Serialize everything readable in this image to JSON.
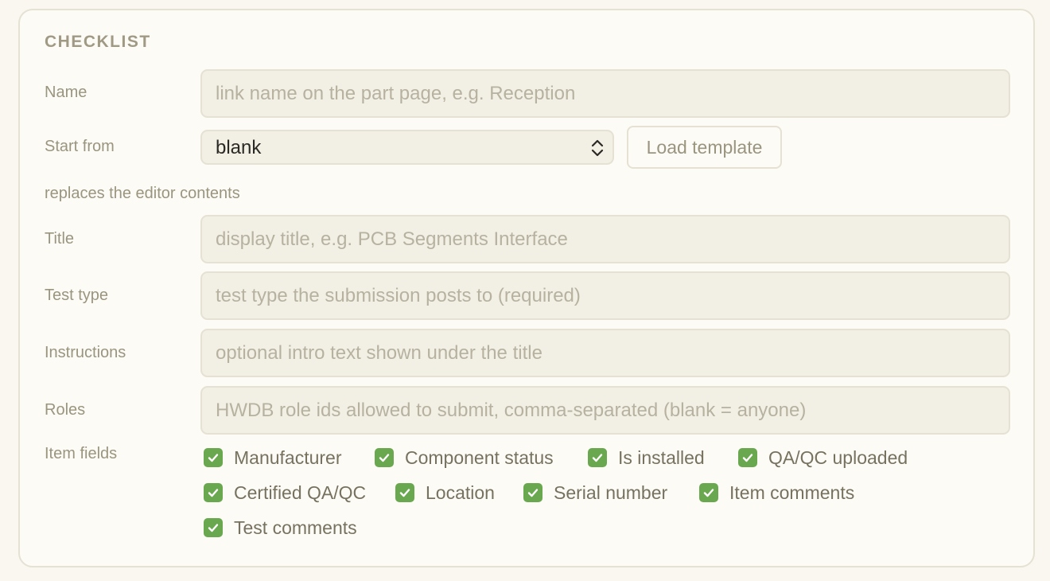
{
  "section": {
    "heading": "CHECKLIST"
  },
  "form": {
    "name": {
      "label": "Name",
      "value": "",
      "placeholder": "link name on the part page, e.g. Reception"
    },
    "start_from": {
      "label": "Start from",
      "value": "blank",
      "load_button": "Load template",
      "hint": "replaces the editor contents"
    },
    "title": {
      "label": "Title",
      "value": "",
      "placeholder": "display title, e.g. PCB Segments Interface"
    },
    "test_type": {
      "label": "Test type",
      "value": "",
      "placeholder": "test type the submission posts to (required)"
    },
    "instructions": {
      "label": "Instructions",
      "value": "",
      "placeholder": "optional intro text shown under the title"
    },
    "roles": {
      "label": "Roles",
      "value": "",
      "placeholder": "HWDB role ids allowed to submit, comma-separated (blank = anyone)"
    },
    "item_fields": {
      "label": "Item fields",
      "options": [
        {
          "label": "Manufacturer",
          "checked": true
        },
        {
          "label": "Component status",
          "checked": true
        },
        {
          "label": "Is installed",
          "checked": true
        },
        {
          "label": "QA/QC uploaded",
          "checked": true
        },
        {
          "label": "Certified QA/QC",
          "checked": true
        },
        {
          "label": "Location",
          "checked": true
        },
        {
          "label": "Serial number",
          "checked": true
        },
        {
          "label": "Item comments",
          "checked": true
        },
        {
          "label": "Test comments",
          "checked": true
        }
      ]
    }
  },
  "colors": {
    "accent_check": "#6aa84f",
    "panel_bg": "#fcfbf6",
    "field_bg": "#f2efe4",
    "label_text": "#9a957f"
  },
  "icons": {
    "checkbox": "checkmark-icon",
    "select": "chevron-updown-icon"
  }
}
